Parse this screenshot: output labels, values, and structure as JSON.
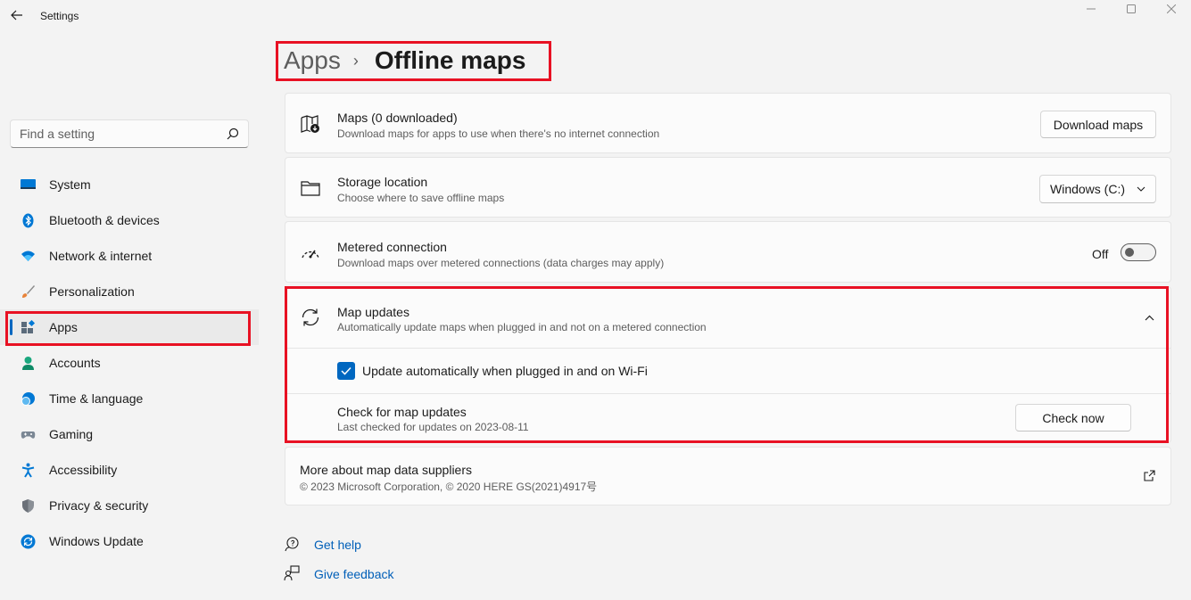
{
  "window": {
    "title": "Settings",
    "back_icon": "back-arrow-icon",
    "controls": [
      "minimize-icon",
      "maximize-icon",
      "close-icon"
    ]
  },
  "search": {
    "placeholder": "Find a setting",
    "icon": "search-icon"
  },
  "sidebar": {
    "items": [
      {
        "label": "System",
        "icon": "system-icon"
      },
      {
        "label": "Bluetooth & devices",
        "icon": "bluetooth-icon"
      },
      {
        "label": "Network & internet",
        "icon": "wifi-icon"
      },
      {
        "label": "Personalization",
        "icon": "brush-icon"
      },
      {
        "label": "Apps",
        "icon": "apps-icon",
        "active": true
      },
      {
        "label": "Accounts",
        "icon": "person-icon"
      },
      {
        "label": "Time & language",
        "icon": "globe-clock-icon"
      },
      {
        "label": "Gaming",
        "icon": "gamepad-icon"
      },
      {
        "label": "Accessibility",
        "icon": "accessibility-icon"
      },
      {
        "label": "Privacy & security",
        "icon": "shield-icon"
      },
      {
        "label": "Windows Update",
        "icon": "update-icon"
      }
    ]
  },
  "header": {
    "parent": "Apps",
    "separator": "›",
    "current": "Offline maps"
  },
  "cards": {
    "maps": {
      "title": "Maps (0 downloaded)",
      "subtitle": "Download maps for apps to use when there's no internet connection",
      "button": "Download maps"
    },
    "storage": {
      "title": "Storage location",
      "subtitle": "Choose where to save offline maps",
      "dropdown": "Windows (C:)"
    },
    "metered": {
      "title": "Metered connection",
      "subtitle": "Download maps over metered connections (data charges may apply)",
      "toggle_label": "Off",
      "toggle_on": false
    },
    "updates": {
      "title": "Map updates",
      "subtitle": "Automatically update maps when plugged in and not on a metered connection",
      "expanded": true,
      "checkbox_label": "Update automatically when plugged in and on Wi-Fi",
      "checkbox_checked": true,
      "check_title": "Check for map updates",
      "check_subtitle": "Last checked for updates on 2023-08-11",
      "check_button": "Check now"
    },
    "suppliers": {
      "title": "More about map data suppliers",
      "subtitle": "© 2023 Microsoft Corporation, © 2020 HERE GS(2021)4917号"
    }
  },
  "footer": {
    "help": "Get help",
    "feedback": "Give feedback"
  },
  "colors": {
    "accent": "#0067c0",
    "highlight": "#e81123",
    "link": "#005fb8"
  }
}
